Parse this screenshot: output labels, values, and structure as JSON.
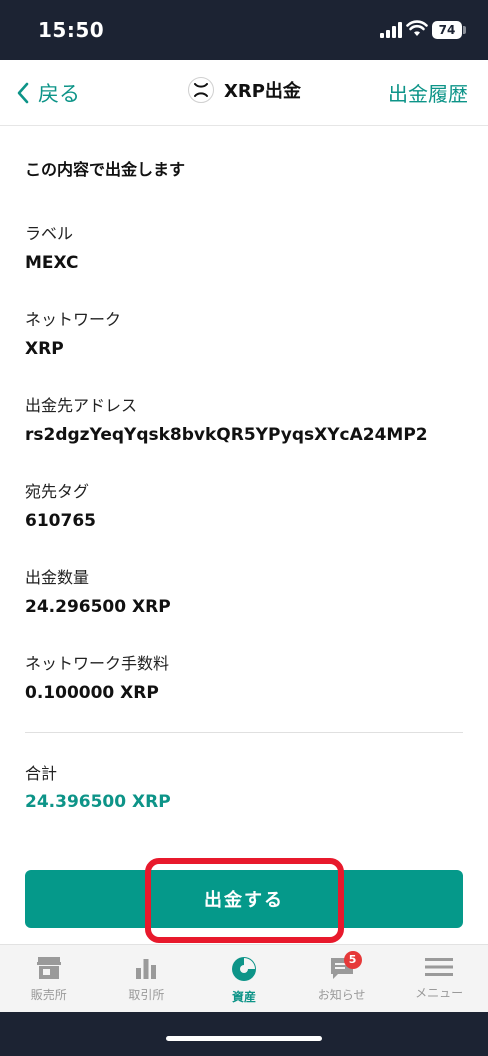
{
  "status_bar": {
    "time": "15:50",
    "battery": "74"
  },
  "header": {
    "back_label": "戻る",
    "title": "XRP出金",
    "history_label": "出金履歴"
  },
  "content": {
    "intro": "この内容で出金します",
    "fields": [
      {
        "label": "ラベル",
        "value": "MEXC"
      },
      {
        "label": "ネットワーク",
        "value": "XRP"
      },
      {
        "label": "出金先アドレス",
        "value": "rs2dgzYeqYqsk8bvkQR5YPyqsXYcA24MP2"
      },
      {
        "label": "宛先タグ",
        "value": "610765"
      },
      {
        "label": "出金数量",
        "value": "24.296500 XRP"
      },
      {
        "label": "ネットワーク手数料",
        "value": "0.100000 XRP"
      }
    ],
    "total": {
      "label": "合計",
      "value": "24.396500 XRP"
    }
  },
  "submit_label": "出金する",
  "tabs": [
    {
      "label": "販売所",
      "icon": "shop-icon"
    },
    {
      "label": "取引所",
      "icon": "bar-chart-icon"
    },
    {
      "label": "資産",
      "icon": "pie-chart-icon",
      "active": true
    },
    {
      "label": "お知らせ",
      "icon": "message-icon",
      "badge": "5"
    },
    {
      "label": "メニュー",
      "icon": "hamburger-icon"
    }
  ],
  "colors": {
    "accent": "#0d9488",
    "button": "#05998a",
    "highlight": "#e8192c",
    "status_bar": "#1c2333"
  }
}
